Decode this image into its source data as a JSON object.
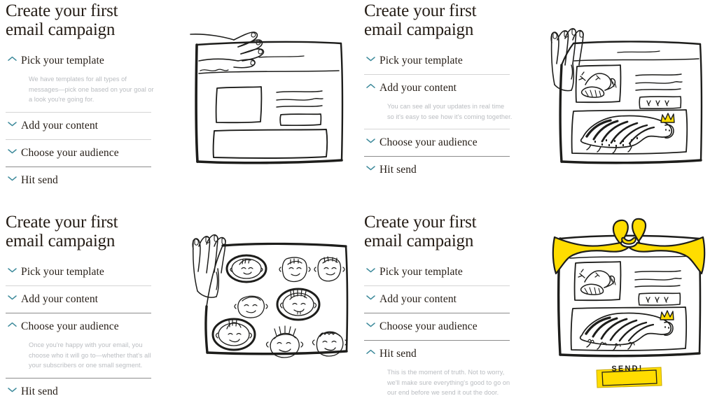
{
  "colors": {
    "accent_chevron": "#3d8a9b",
    "title_text": "#241c15",
    "body_text": "#b9bcc0",
    "divider": "#d4d4d4",
    "divider_strong": "#8c8c8c",
    "illustration_ink": "#1d1d1b",
    "highlight_yellow": "#ffdd00",
    "page_background": "#ffffff"
  },
  "panels": [
    {
      "title": "Create your first\nemail campaign",
      "expanded_index": 0,
      "items": [
        {
          "label": "Pick your template",
          "icon": "chevron-up-icon",
          "body": "We have templates for all types of messages—pick one based on your goal or a look you're going for."
        },
        {
          "label": "Add your content",
          "icon": "chevron-down-icon",
          "body": ""
        },
        {
          "label": "Choose your audience",
          "icon": "chevron-down-icon",
          "body": ""
        },
        {
          "label": "Hit send",
          "icon": "chevron-down-icon",
          "body": ""
        }
      ],
      "illustration": {
        "name": "wireframe-empty-template",
        "description": "Hand-drawn email wireframe with empty placeholder blocks and a hand reaching in from the top left",
        "labels": []
      }
    },
    {
      "title": "Create your first\nemail campaign",
      "expanded_index": 1,
      "items": [
        {
          "label": "Pick your template",
          "icon": "chevron-down-icon",
          "body": ""
        },
        {
          "label": "Add your content",
          "icon": "chevron-up-icon",
          "body": "You can see all your updates in real time so it's easy to see how it's coming together."
        },
        {
          "label": "Choose your audience",
          "icon": "chevron-down-icon",
          "body": ""
        },
        {
          "label": "Hit send",
          "icon": "chevron-down-icon",
          "body": ""
        }
      ],
      "illustration": {
        "name": "wireframe-filled-content",
        "description": "Hand-drawn email wireframe filled with a bird drawing and a large striped crowned creature, hand reaching in from the left",
        "labels": []
      }
    },
    {
      "title": "Create your first\nemail campaign",
      "expanded_index": 2,
      "items": [
        {
          "label": "Pick your template",
          "icon": "chevron-down-icon",
          "body": ""
        },
        {
          "label": "Add your content",
          "icon": "chevron-down-icon",
          "body": ""
        },
        {
          "label": "Choose your audience",
          "icon": "chevron-up-icon",
          "body": "Once you're happy with your email, you choose who it will go to—whether that's all your subscribers or one small segment."
        },
        {
          "label": "Hit send",
          "icon": "chevron-down-icon",
          "body": ""
        }
      ],
      "illustration": {
        "name": "audience-faces-grid",
        "description": "Hand-drawn grid of nine faces, three circled with bold ovals to show selected audience, hand reaching in from the left",
        "labels": []
      }
    },
    {
      "title": "Create your first\nemail campaign",
      "expanded_index": 3,
      "items": [
        {
          "label": "Pick your template",
          "icon": "chevron-down-icon",
          "body": ""
        },
        {
          "label": "Add your content",
          "icon": "chevron-down-icon",
          "body": ""
        },
        {
          "label": "Choose your audience",
          "icon": "chevron-down-icon",
          "body": ""
        },
        {
          "label": "Hit send",
          "icon": "chevron-up-icon",
          "body": "This is the moment of truth. Not to worry, we'll make sure everything's good to go on our end before we send it out the door."
        }
      ],
      "illustration": {
        "name": "gift-wrapped-email-send",
        "description": "Hand-drawn email wireframe wrapped with a yellow ribbon bow, with a yellow SEND! button below",
        "labels": [
          "SEND!"
        ]
      }
    }
  ]
}
